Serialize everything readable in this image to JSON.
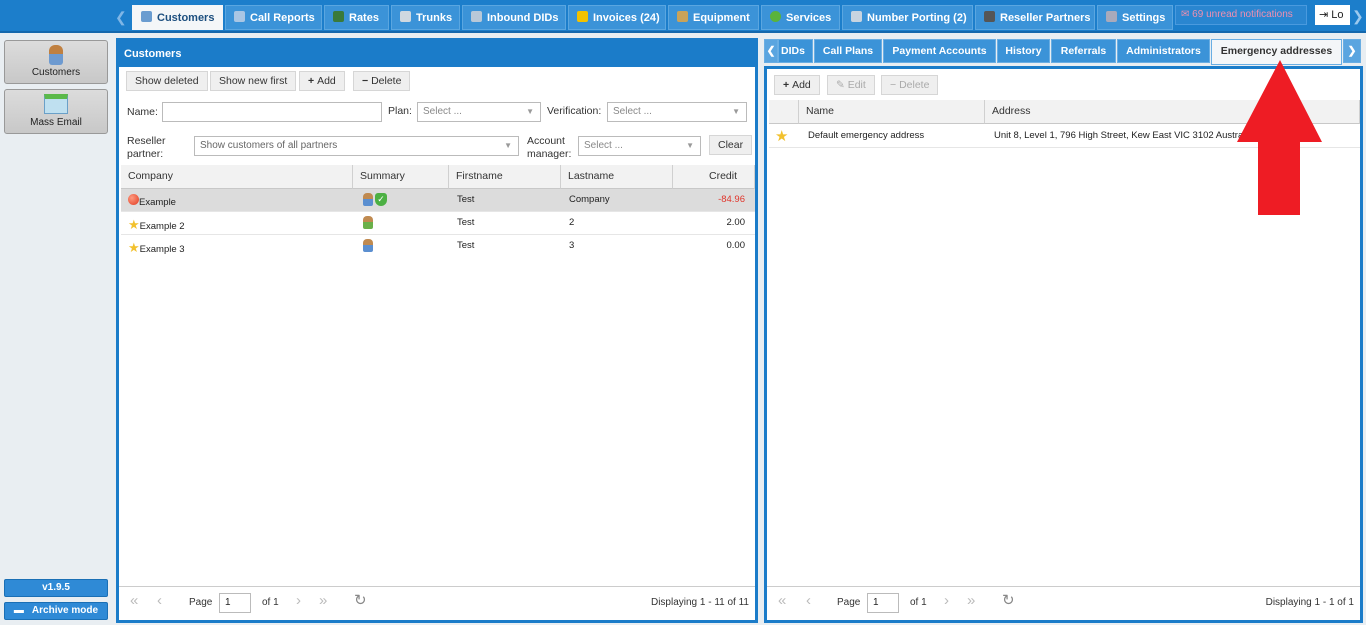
{
  "top_tabs": [
    {
      "label": "Customers",
      "icon": "user-icon",
      "active": true
    },
    {
      "label": "Call Reports",
      "icon": "report-icon"
    },
    {
      "label": "Rates",
      "icon": "rates-icon"
    },
    {
      "label": "Trunks",
      "icon": "trunk-icon"
    },
    {
      "label": "Inbound DIDs",
      "icon": "did-icon"
    },
    {
      "label": "Invoices (24)",
      "icon": "coins-icon"
    },
    {
      "label": "Equipment",
      "icon": "box-icon"
    },
    {
      "label": "Services",
      "icon": "services-icon"
    },
    {
      "label": "Number Porting (2)",
      "icon": "phone-icon"
    },
    {
      "label": "Reseller Partners",
      "icon": "partner-icon"
    },
    {
      "label": "Settings",
      "icon": "gear-icon"
    }
  ],
  "notifications": "69 unread notifications",
  "logout": "Lo",
  "sidebar": {
    "items": [
      {
        "label": "Customers",
        "icon": "user-icon"
      },
      {
        "label": "Mass Email",
        "icon": "mail-icon"
      }
    ],
    "version": "v1.9.5",
    "archive": "Archive mode"
  },
  "customers": {
    "title": "Customers",
    "toolbar": {
      "show_deleted": "Show deleted",
      "show_new_first": "Show new first",
      "add": "Add",
      "delete": "Delete"
    },
    "filters": {
      "name_label": "Name:",
      "name_value": "",
      "plan_label": "Plan:",
      "plan_placeholder": "Select ...",
      "verification_label": "Verification:",
      "verification_placeholder": "Select ...",
      "reseller_label_1": "Reseller",
      "reseller_label_2": "partner:",
      "reseller_value": "Show customers of all partners",
      "manager_label_1": "Account",
      "manager_label_2": "manager:",
      "manager_placeholder": "Select ...",
      "clear": "Clear"
    },
    "columns": [
      "Company",
      "Summary",
      "Firstname",
      "Lastname",
      "Credit"
    ],
    "rows": [
      {
        "company": "Example",
        "status": "red-dot",
        "firstname": "Test",
        "lastname": "Company",
        "credit": "-84.96",
        "selected": true
      },
      {
        "company": "Example 2",
        "status": "star",
        "firstname": "Test",
        "lastname": "2",
        "credit": "2.00"
      },
      {
        "company": "Example 3",
        "status": "star",
        "firstname": "Test",
        "lastname": "3",
        "credit": "0.00"
      }
    ],
    "paging": {
      "page_label": "Page",
      "page": "1",
      "of": "of 1",
      "display": "Displaying 1 - 11 of 11"
    }
  },
  "detail": {
    "tabs": [
      "DIDs",
      "Call Plans",
      "Payment Accounts",
      "History",
      "Referrals",
      "Administrators",
      "Emergency addresses"
    ],
    "active_tab": "Emergency addresses",
    "toolbar": {
      "add": "Add",
      "edit": "Edit",
      "delete": "Delete"
    },
    "columns": [
      "Name",
      "Address"
    ],
    "rows": [
      {
        "name": "Default emergency address",
        "address": "Unit 8, Level 1, 796 High Street, Kew East VIC 3102 Australia",
        "default": true
      }
    ],
    "paging": {
      "page_label": "Page",
      "page": "1",
      "of": "of 1",
      "display": "Displaying 1 - 1 of 1"
    }
  },
  "colors": {
    "accent": "#1b7cc9",
    "negative": "#e0352b",
    "arrow": "#ee1c24"
  }
}
